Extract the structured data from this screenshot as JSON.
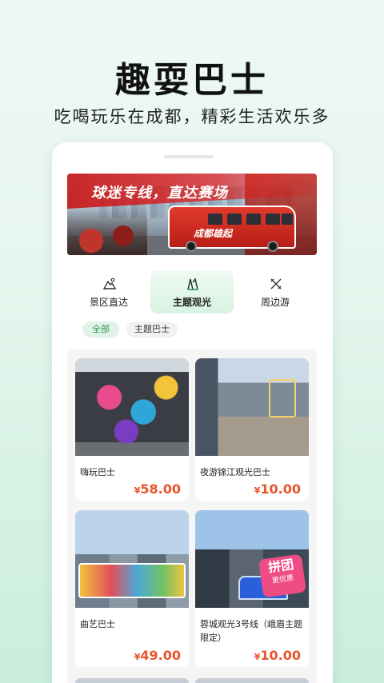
{
  "hero": {
    "title": "趣耍巴士",
    "subtitle": "吃喝玩乐在成都，精彩生活欢乐多"
  },
  "banner": {
    "slogan": "球迷专线，直达赛场",
    "bus_text": "成都雄起"
  },
  "tabs": [
    {
      "label": "景区直达",
      "icon": "scenic-icon",
      "active": false
    },
    {
      "label": "主题观光",
      "icon": "theme-icon",
      "active": true
    },
    {
      "label": "周边游",
      "icon": "around-icon",
      "active": false
    }
  ],
  "filters": [
    {
      "label": "全部",
      "selected": true
    },
    {
      "label": "主题巴士",
      "selected": false
    }
  ],
  "products": [
    {
      "name": "嗨玩巴士",
      "currency": "¥",
      "price": "58.00"
    },
    {
      "name": "夜游锦江观光巴士",
      "currency": "¥",
      "price": "10.00"
    },
    {
      "name": "曲艺巴士",
      "currency": "¥",
      "price": "49.00"
    },
    {
      "name": "蓉城观光3号线（峨眉主题限定）",
      "currency": "¥",
      "price": "10.00",
      "badge": "拼团",
      "badge_sub": "更优惠"
    }
  ],
  "colors": {
    "price": "#e8552a",
    "accent_green": "#2d9b55"
  }
}
